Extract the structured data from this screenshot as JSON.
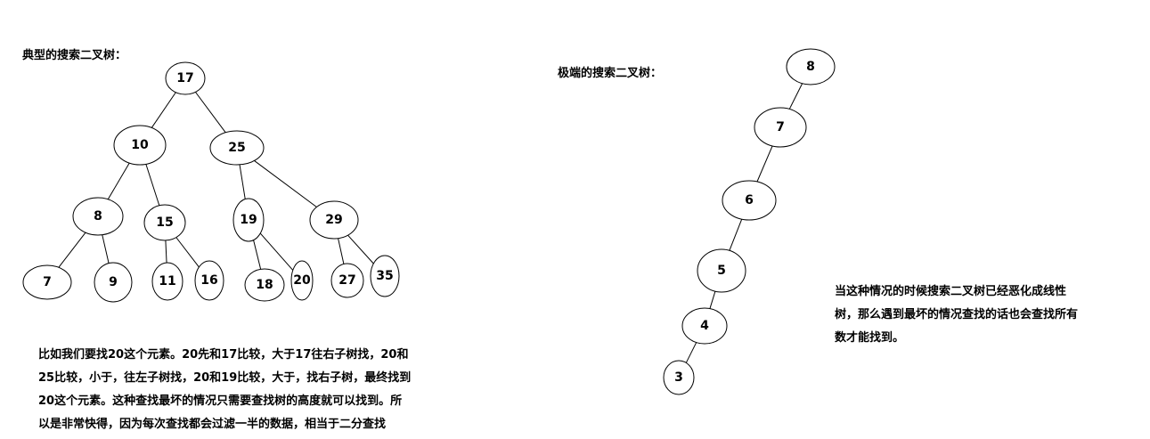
{
  "typical": {
    "title": "典型的搜索二叉树：",
    "nodes": [
      {
        "id": "n17",
        "label": "17"
      },
      {
        "id": "n10",
        "label": "10"
      },
      {
        "id": "n25",
        "label": "25"
      },
      {
        "id": "n8",
        "label": "8"
      },
      {
        "id": "n15",
        "label": "15"
      },
      {
        "id": "n19",
        "label": "19"
      },
      {
        "id": "n29",
        "label": "29"
      },
      {
        "id": "n7",
        "label": "7"
      },
      {
        "id": "n9",
        "label": "9"
      },
      {
        "id": "n11",
        "label": "11"
      },
      {
        "id": "n16",
        "label": "16"
      },
      {
        "id": "n18",
        "label": "18"
      },
      {
        "id": "n20",
        "label": "20"
      },
      {
        "id": "n27",
        "label": "27"
      },
      {
        "id": "n35",
        "label": "35"
      }
    ],
    "edges": [
      [
        "n17",
        "n10"
      ],
      [
        "n17",
        "n25"
      ],
      [
        "n10",
        "n8"
      ],
      [
        "n10",
        "n15"
      ],
      [
        "n25",
        "n19"
      ],
      [
        "n25",
        "n29"
      ],
      [
        "n8",
        "n7"
      ],
      [
        "n8",
        "n9"
      ],
      [
        "n15",
        "n11"
      ],
      [
        "n15",
        "n16"
      ],
      [
        "n19",
        "n18"
      ],
      [
        "n19",
        "n20"
      ],
      [
        "n29",
        "n27"
      ],
      [
        "n29",
        "n35"
      ]
    ],
    "explanation": [
      "比如我们要找20这个元素。20先和17比较，大于17往右子树找，20和",
      "25比较，小于，往左子树找，20和19比较，大于，找右子树，最终找到",
      "20这个元素。这种查找最坏的情况只需要查找树的高度就可以找到。所",
      "以是非常快得，因为每次查找都会过滤一半的数据，相当于二分查找"
    ]
  },
  "extreme": {
    "title": "极端的搜索二叉树：",
    "nodes": [
      {
        "id": "e8",
        "label": "8"
      },
      {
        "id": "e7",
        "label": "7"
      },
      {
        "id": "e6",
        "label": "6"
      },
      {
        "id": "e5",
        "label": "5"
      },
      {
        "id": "e4",
        "label": "4"
      },
      {
        "id": "e3",
        "label": "3"
      }
    ],
    "edges": [
      [
        "e8",
        "e7"
      ],
      [
        "e7",
        "e6"
      ],
      [
        "e6",
        "e5"
      ],
      [
        "e5",
        "e4"
      ],
      [
        "e4",
        "e3"
      ]
    ],
    "explanation": [
      "当这种情况的时候搜索二叉树已经恶化成线性",
      "树，那么遇到最坏的情况查找的话也会查找所有",
      "数才能找到。"
    ]
  }
}
